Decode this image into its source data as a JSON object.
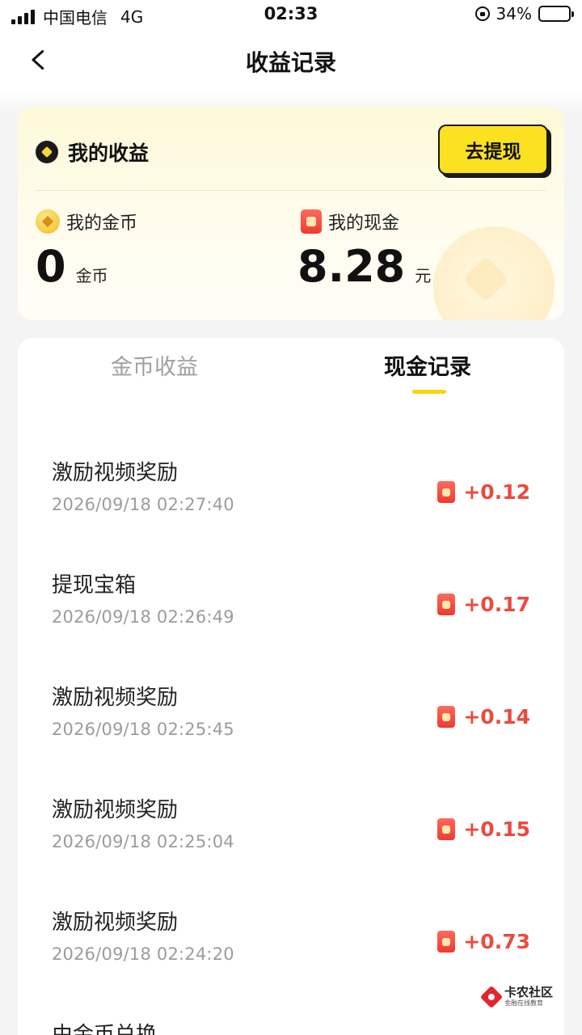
{
  "status_bar": {
    "carrier": "中国电信",
    "network": "4G",
    "time": "02:33",
    "battery": "34%",
    "battery_level": 0.34
  },
  "nav": {
    "title": "收益记录"
  },
  "earnings": {
    "title": "我的收益",
    "withdraw_label": "去提现",
    "coins_label": "我的金币",
    "coins_value": "0",
    "coins_unit": "金币",
    "cash_label": "我的现金",
    "cash_value": "8.28",
    "cash_unit": "元"
  },
  "tabs": [
    {
      "label": "金币收益",
      "active": false
    },
    {
      "label": "现金记录",
      "active": true
    }
  ],
  "records": [
    {
      "title": "激励视频奖励",
      "time": "2026/09/18 02:27:40",
      "amount": "+0.12"
    },
    {
      "title": "提现宝箱",
      "time": "2026/09/18 02:26:49",
      "amount": "+0.17"
    },
    {
      "title": "激励视频奖励",
      "time": "2026/09/18 02:25:45",
      "amount": "+0.14"
    },
    {
      "title": "激励视频奖励",
      "time": "2026/09/18 02:25:04",
      "amount": "+0.15"
    },
    {
      "title": "激励视频奖励",
      "time": "2026/09/18 02:24:20",
      "amount": "+0.73"
    },
    {
      "title": "由金币兑换",
      "time": "",
      "amount": ""
    }
  ],
  "watermark": {
    "name": "卡农社区",
    "subtitle": "金融在线教育"
  },
  "colors": {
    "accent_yellow": "#fbe11f",
    "amount_red": "#ec4a3c",
    "tab_underline": "#f7d511"
  }
}
